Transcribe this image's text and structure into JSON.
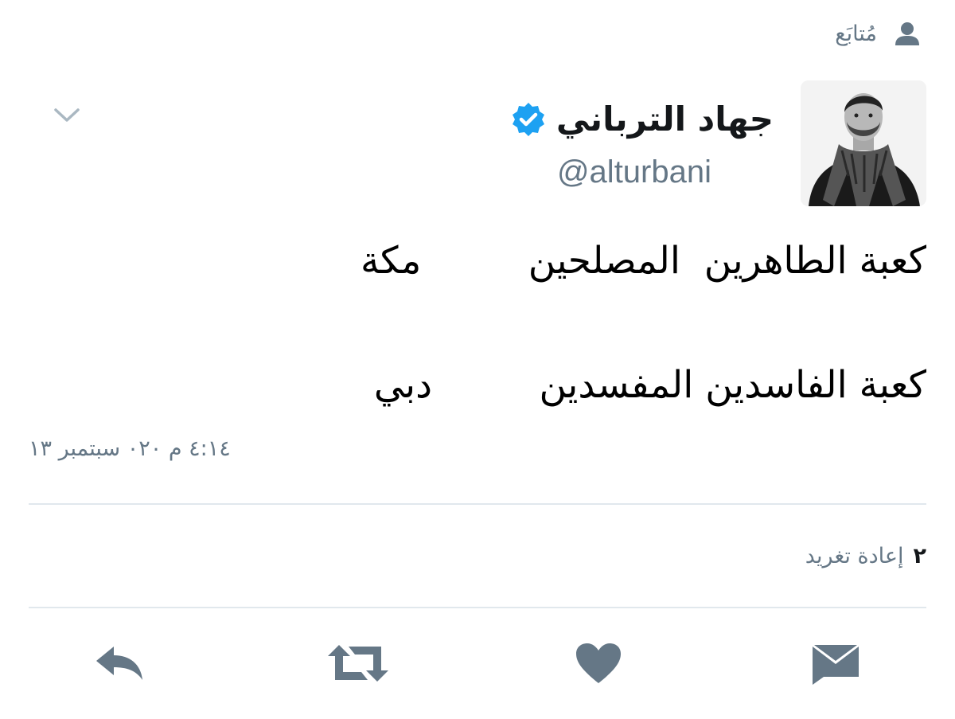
{
  "header": {
    "following_label": "مُتابَع",
    "following_icon": "person-icon"
  },
  "author": {
    "display_name": "جهاد الترباني",
    "handle": "@alturbani",
    "verified": true,
    "verified_color": "#1da1f2"
  },
  "tweet": {
    "lines": [
      "كعبة الطاهرين  المصلحين         مكة",
      "كعبة الفاسدين المفسدين         دبي"
    ],
    "timestamp": "٤:١٤ م ٠٢٠ سبتمبر ١٣"
  },
  "stats": {
    "retweet_count": "٢",
    "retweet_label": "إعادة تغريد"
  },
  "actions": {
    "reply_icon": "reply-icon",
    "retweet_icon": "retweet-icon",
    "like_icon": "heart-icon",
    "dm_icon": "envelope-icon"
  },
  "colors": {
    "icon_gray": "#657786",
    "divider": "#e1e8ed",
    "text": "#14171a"
  }
}
